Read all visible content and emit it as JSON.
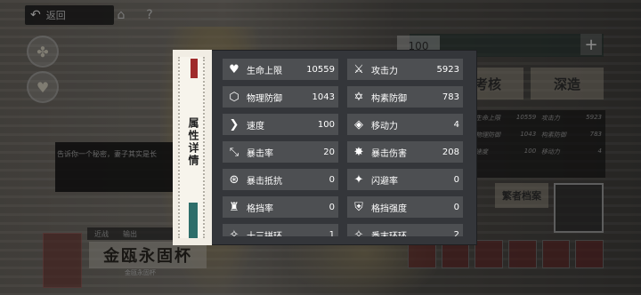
{
  "nav": {
    "back_label": "返回",
    "home_icon": "home-icon",
    "help_label": "?"
  },
  "modal": {
    "side_title": "属性详情",
    "stats": [
      {
        "label": "生命上限",
        "value": "10559",
        "icon": "heart-icon"
      },
      {
        "label": "攻击力",
        "value": "5923",
        "icon": "crossed-swords-icon"
      },
      {
        "label": "物理防御",
        "value": "1043",
        "icon": "shield-icon"
      },
      {
        "label": "构素防御",
        "value": "783",
        "icon": "star-shield-icon"
      },
      {
        "label": "速度",
        "value": "100",
        "icon": "chevron-right-icon"
      },
      {
        "label": "移动力",
        "value": "4",
        "icon": "layers-icon"
      },
      {
        "label": "暴击率",
        "value": "20",
        "icon": "crit-rate-icon"
      },
      {
        "label": "暴击伤害",
        "value": "208",
        "icon": "crit-damage-icon"
      },
      {
        "label": "暴击抵抗",
        "value": "0",
        "icon": "crit-resist-icon"
      },
      {
        "label": "闪避率",
        "value": "0",
        "icon": "dodge-icon"
      },
      {
        "label": "格挡率",
        "value": "0",
        "icon": "block-rate-icon"
      },
      {
        "label": "格挡强度",
        "value": "0",
        "icon": "block-strength-icon"
      },
      {
        "label": "十三拼环",
        "value": "1",
        "icon": "misc-icon"
      },
      {
        "label": "番末环环",
        "value": "2",
        "icon": "misc-icon"
      }
    ]
  },
  "background": {
    "tooltip_text": "告诉你一个秘密，妻子其实是长",
    "bottom_tabs": [
      "近战",
      "输出"
    ],
    "banner_title": "金瓯永固杯",
    "banner_sub": "金瓯永固杯",
    "right_count": "100",
    "right_btn_exam": "考核",
    "right_btn_forge": "深造",
    "right_archive": "繁者档案",
    "right_stats": [
      {
        "label": "生命上限",
        "value": "10559"
      },
      {
        "label": "攻击力",
        "value": "5923"
      },
      {
        "label": "物理防御",
        "value": "1043"
      },
      {
        "label": "构素防御",
        "value": "783"
      },
      {
        "label": "速度",
        "value": "100"
      },
      {
        "label": "移动力",
        "value": "4"
      }
    ],
    "badge_label": "秘密"
  }
}
